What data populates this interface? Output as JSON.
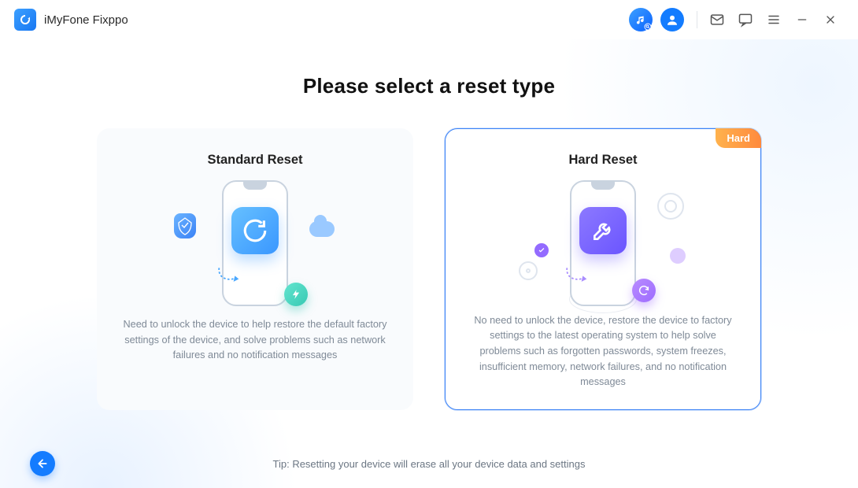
{
  "app": {
    "title": "iMyFone Fixppo"
  },
  "titlebar_icons": {
    "music": "music-note-icon",
    "user": "user-icon",
    "mail": "mail-icon",
    "feedback": "comment-icon",
    "menu": "menu-icon",
    "minimize": "minimize-icon",
    "close": "close-icon"
  },
  "page": {
    "heading": "Please select a reset type",
    "tip": "Tip: Resetting your device will erase all your device data and settings"
  },
  "cards": {
    "standard": {
      "title": "Standard Reset",
      "desc": "Need to unlock the device to help restore the default factory settings of the device, and solve problems such as network failures and no notification messages"
    },
    "hard": {
      "title": "Hard Reset",
      "badge": "Hard",
      "desc": "No need to unlock the device, restore the device to factory settings to the latest operating system to help solve problems such as forgotten passwords, system freezes, insufficient memory, network failures, and no notification messages"
    }
  },
  "selected": "hard"
}
